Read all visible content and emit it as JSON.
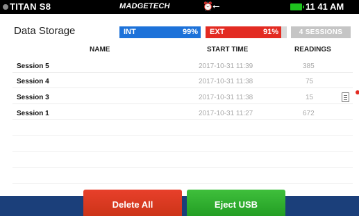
{
  "status_bar": {
    "device_name": "TITAN S8",
    "brand": "MADGETECH",
    "alarm_icon": "alarm-icon",
    "usb_icon": "usb-icon",
    "battery_icon": "battery-icon",
    "time": "11 41 AM"
  },
  "header": {
    "title": "Data Storage",
    "int_label": "INT",
    "int_percent": "99%",
    "ext_label": "EXT",
    "ext_percent": "91%",
    "sessions_button": "4 SESSIONS"
  },
  "table": {
    "columns": [
      "NAME",
      "START TIME",
      "READINGS"
    ],
    "rows": [
      {
        "name": "Session 5",
        "start_time": "2017-10-31 11:39",
        "readings": "385"
      },
      {
        "name": "Session 4",
        "start_time": "2017-10-31 11:38",
        "readings": "75"
      },
      {
        "name": "Session 3",
        "start_time": "2017-10-31 11:38",
        "readings": "15"
      },
      {
        "name": "Session 1",
        "start_time": "2017-10-31 11:27",
        "readings": "672"
      }
    ]
  },
  "actions": {
    "delete_all": "Delete All",
    "eject_usb": "Eject USB"
  },
  "colors": {
    "int_bar": "#1d72d9",
    "ext_bar": "#e32b22",
    "delete_button": "#d9391f",
    "eject_button": "#2fae2e",
    "bottom_bar": "#1b3f7a"
  }
}
